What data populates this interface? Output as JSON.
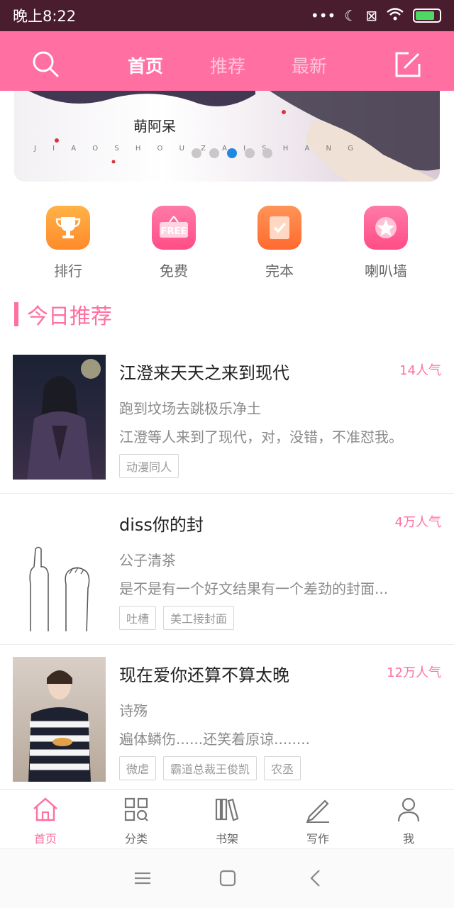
{
  "status": {
    "time": "晚上8:22"
  },
  "topbar": {
    "tabs": [
      "首页",
      "推荐",
      "最新"
    ]
  },
  "banner": {
    "author": "萌阿呆",
    "pinyin": "J I A O S H O U Z A I S H A N G"
  },
  "shortcuts": [
    {
      "label": "排行",
      "color": "#ff9a3d"
    },
    {
      "label": "免费",
      "color": "#ff5d93"
    },
    {
      "label": "完本",
      "color": "#ff7a44"
    },
    {
      "label": "喇叭墙",
      "color": "#ff5d93"
    }
  ],
  "section": {
    "title": "今日推荐"
  },
  "books": [
    {
      "title": "江澄来天天之来到现代",
      "popularity": "14人气",
      "author": "跑到坟场去跳极乐净土",
      "desc": "江澄等人来到了现代，对，没错，不准怼我。",
      "tags": [
        "动漫同人"
      ]
    },
    {
      "title": "diss你的封",
      "popularity": "4万人气",
      "author": "公子清茶",
      "desc": "是不是有一个好文结果有一个差劲的封面...",
      "tags": [
        "吐槽",
        "美工接封面"
      ]
    },
    {
      "title": "现在爱你还算不算太晚",
      "popularity": "12万人气",
      "author": "诗殇",
      "desc": "遍体鳞伤......还笑着原谅........",
      "tags": [
        "微虐",
        "霸道总裁王俊凯",
        "农丞"
      ]
    }
  ],
  "tabbar": {
    "items": [
      "首页",
      "分类",
      "书架",
      "写作",
      "我"
    ]
  },
  "colors": {
    "accent": "#ff6fa2",
    "statusbar": "#4a1d2e"
  }
}
